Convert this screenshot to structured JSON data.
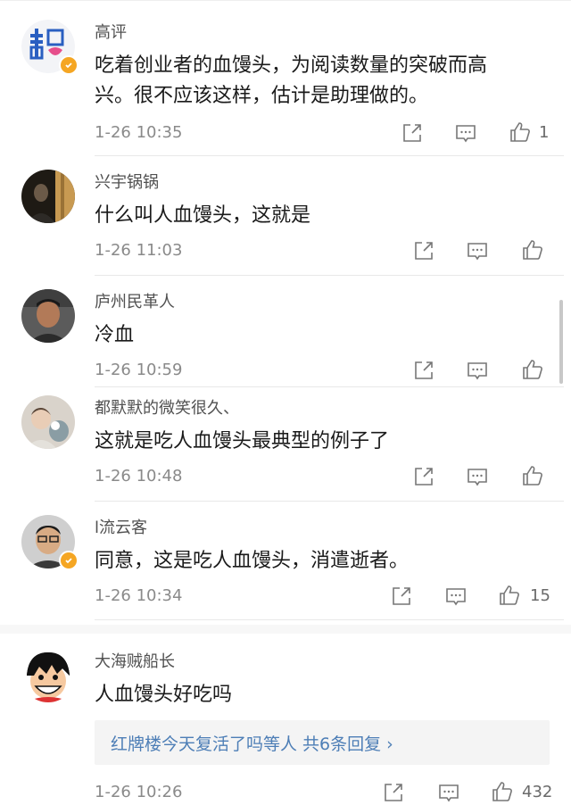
{
  "colors": {
    "accent_link": "#4d7eb6",
    "verified_badge": "#f5a623",
    "text": "#1a1a1a",
    "meta": "#8a8a8a"
  },
  "comments": [
    {
      "name": "高评",
      "line1": "吃着创业者的血馒头，为阅读数量的突破而高",
      "line2": "兴。很不应该这样，估计是助理做的。",
      "time": "1-26 10:35",
      "likes": "1",
      "avatar_icon": "qingdao-logo-avatar",
      "verified": true
    },
    {
      "name": "兴宇锅锅",
      "line1": "什么叫人血馒头，这就是",
      "time": "1-26 11:03",
      "likes": "",
      "avatar_icon": "photo-avatar",
      "verified": false
    },
    {
      "name": "庐州民革人",
      "line1": "冷血",
      "time": "1-26 10:59",
      "likes": "",
      "avatar_icon": "photo-avatar",
      "verified": false
    },
    {
      "name": "都默默的微笑很久、",
      "line1": "这就是吃人血馒头最典型的例子了",
      "time": "1-26 10:48",
      "likes": "",
      "avatar_icon": "photo-avatar",
      "verified": false
    },
    {
      "name": "l流云客",
      "line1": "同意，这是吃人血馒头，消遣逝者。",
      "time": "1-26 10:34",
      "likes": "15",
      "avatar_icon": "photo-avatar",
      "verified": true
    },
    {
      "name": "大海贼船长",
      "line1": "人血馒头好吃吗",
      "time": "1-26 10:26",
      "likes": "432",
      "avatar_icon": "cartoon-avatar",
      "verified": false,
      "reply_summary": "红牌楼今天复活了吗等人  共6条回复 ›"
    }
  ],
  "icons": {
    "share": "share-icon",
    "comment": "comment-icon",
    "like": "like-icon"
  }
}
